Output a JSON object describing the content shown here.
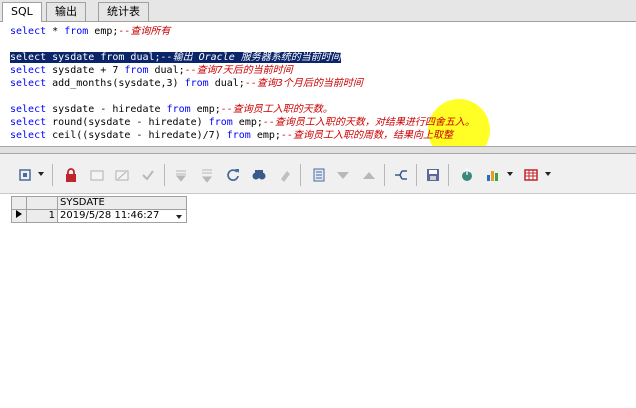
{
  "tabs": [
    {
      "label": "SQL",
      "active": true
    },
    {
      "label": "输出",
      "active": false
    },
    {
      "label": "统计表",
      "active": false
    }
  ],
  "editor": {
    "lines": [
      {
        "id": "l1",
        "parts": [
          {
            "t": "kw",
            "v": "select"
          },
          {
            "t": "tx",
            "v": " * "
          },
          {
            "t": "kw",
            "v": "from"
          },
          {
            "t": "tx",
            "v": " emp;"
          },
          {
            "t": "cm",
            "v": "--查询所有"
          }
        ]
      },
      {
        "id": "l2",
        "selected": true,
        "parts": [
          {
            "t": "kw",
            "v": "select"
          },
          {
            "t": "tx",
            "v": " sysdate "
          },
          {
            "t": "kw",
            "v": "from"
          },
          {
            "t": "tx",
            "v": " dual;"
          },
          {
            "t": "cm",
            "v": "--输出 Oracle 服务器系统的当前时间"
          }
        ]
      },
      {
        "id": "l3",
        "parts": [
          {
            "t": "kw",
            "v": "select"
          },
          {
            "t": "tx",
            "v": " sysdate + 7 "
          },
          {
            "t": "kw",
            "v": "from"
          },
          {
            "t": "tx",
            "v": " dual;"
          },
          {
            "t": "cm",
            "v": "--查询7天后的当前时间"
          }
        ]
      },
      {
        "id": "l4",
        "parts": [
          {
            "t": "kw",
            "v": "select"
          },
          {
            "t": "tx",
            "v": " add_months(sysdate,3) "
          },
          {
            "t": "kw",
            "v": "from"
          },
          {
            "t": "tx",
            "v": " dual;"
          },
          {
            "t": "cm",
            "v": "--查询3个月后的当前时间"
          }
        ]
      },
      {
        "id": "l5",
        "parts": [
          {
            "t": "kw",
            "v": "select"
          },
          {
            "t": "tx",
            "v": " sysdate - hiredate "
          },
          {
            "t": "kw",
            "v": "from"
          },
          {
            "t": "tx",
            "v": " emp;"
          },
          {
            "t": "cm",
            "v": "--查询员工入职的天数。"
          }
        ]
      },
      {
        "id": "l6",
        "parts": [
          {
            "t": "kw",
            "v": "select"
          },
          {
            "t": "tx",
            "v": " round(sysdate - hiredate) "
          },
          {
            "t": "kw",
            "v": "from"
          },
          {
            "t": "tx",
            "v": " emp;"
          },
          {
            "t": "cm",
            "v": "--查询员工入职的天数，对结果进行四舍五入。"
          }
        ]
      },
      {
        "id": "l7",
        "parts": [
          {
            "t": "kw",
            "v": "select"
          },
          {
            "t": "tx",
            "v": " ceil((sysdate - hiredate)/7) "
          },
          {
            "t": "kw",
            "v": "from"
          },
          {
            "t": "tx",
            "v": " emp;"
          },
          {
            "t": "cm",
            "v": "--查询员工入职的周数，结果向上取整"
          }
        ]
      }
    ]
  },
  "toolbar": {
    "icons": [
      "grid-options-icon",
      "lock-icon",
      "new-record-icon",
      "delete-record-icon",
      "post-icon",
      "fetch-next-icon",
      "fetch-all-icon",
      "refresh-icon",
      "find-icon",
      "clear-icon",
      "single-record-view-icon",
      "filter-down-icon",
      "filter-up-icon",
      "link-icon",
      "save-icon",
      "export-icon",
      "chart-icon",
      "table-export-icon"
    ]
  },
  "grid": {
    "column": "SYSDATE",
    "rows": [
      {
        "num": "1",
        "value": "2019/5/28 11:46:27"
      }
    ]
  }
}
